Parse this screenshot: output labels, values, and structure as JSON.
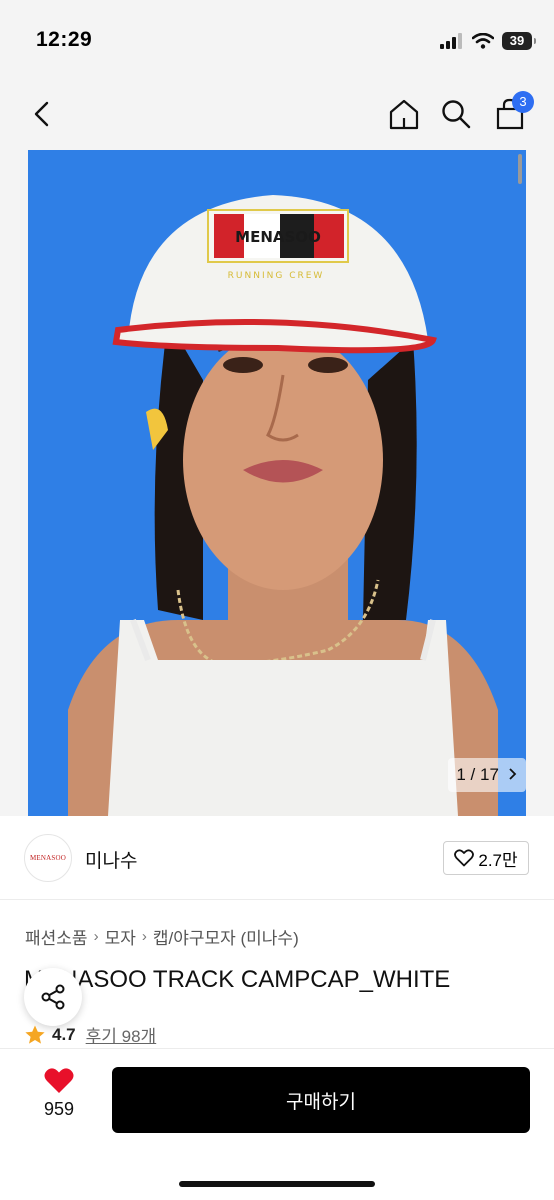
{
  "status": {
    "time": "12:29",
    "battery": "39"
  },
  "nav": {
    "cart_count": "3"
  },
  "gallery": {
    "counter": "1 / 17",
    "cap_logo_text": "MENASOO",
    "cap_sub_text": "RUNNING CREW"
  },
  "brand": {
    "logo_text": "MENASOO",
    "name": "미나수",
    "like_count": "2.7만"
  },
  "breadcrumb": {
    "items": [
      "패션소품",
      "모자",
      "캡/야구모자 (미나수)"
    ]
  },
  "product": {
    "title": "MENASOO TRACK CAMPCAP_WHITE",
    "rating": "4.7",
    "review_label": "후기 98개"
  },
  "bottom": {
    "wish_count": "959",
    "buy_label": "구매하기"
  },
  "colors": {
    "accent_badge": "#2e6ef2",
    "photo_background": "#2f7fe6",
    "heart_red": "#e8102a",
    "star": "#f5a623",
    "buy_button": "#000000"
  },
  "icons": [
    "back-arrow-icon",
    "home-icon",
    "search-icon",
    "shopping-bag-icon",
    "chevron-right-icon",
    "heart-outline-icon",
    "share-icon",
    "star-icon",
    "heart-filled-icon"
  ]
}
